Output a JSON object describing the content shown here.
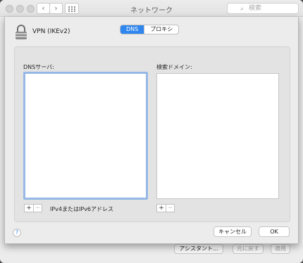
{
  "window": {
    "title": "ネットワーク",
    "search_placeholder": "検索"
  },
  "sheet": {
    "vpn_name": "VPN (IKEv2)",
    "tabs": [
      {
        "label": "DNS",
        "active": true
      },
      {
        "label": "プロキシ",
        "active": false
      }
    ],
    "dns_server_label": "DNSサーバ:",
    "search_domain_label": "検索ドメイン:",
    "add_symbol": "+",
    "remove_symbol": "−",
    "address_hint": "IPv4またはIPv6アドレス",
    "help_symbol": "?",
    "cancel_label": "キャンセル",
    "ok_label": "OK"
  },
  "background_buttons": {
    "assistant": "アシスタント...",
    "revert": "元に戻す",
    "apply": "適用"
  },
  "colors": {
    "accent": "#2f86ee",
    "focus_ring": "#96b8e6"
  },
  "icons": [
    "back-icon",
    "forward-icon",
    "grid-icon",
    "search-icon",
    "lock-icon",
    "help-icon"
  ]
}
